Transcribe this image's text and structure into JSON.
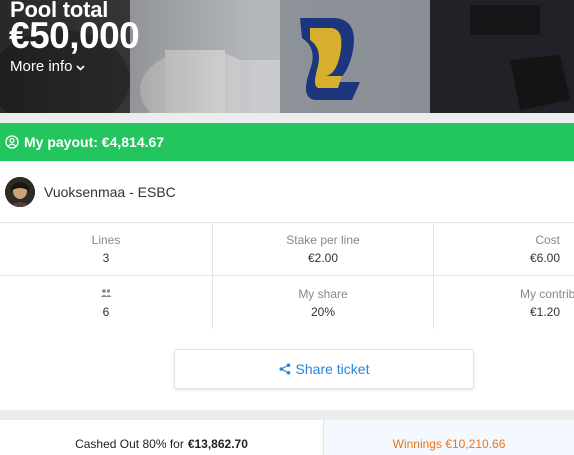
{
  "hero": {
    "pool_label": "Pool total",
    "pool_amount": "€50,000",
    "more_info": "More info"
  },
  "payout": {
    "text": "My payout: €4,814.67",
    "color": "#22c55e"
  },
  "user": {
    "name": "Vuoksenmaa - ESBC"
  },
  "stats": {
    "lines_label": "Lines",
    "lines_value": "3",
    "stake_label": "Stake per line",
    "stake_value": "€2.00",
    "cost_label": "Cost",
    "cost_value": "€6.00",
    "participants_icon": "people-icon",
    "participants_value": "6",
    "share_label": "My share",
    "share_value": "20%",
    "contribution_label": "My contributi",
    "contribution_value": "€1.20"
  },
  "share_button": {
    "label": "Share ticket",
    "icon": "share-icon",
    "color": "#2b84d6"
  },
  "bottom": {
    "cashed_prefix": "Cashed Out 80% for",
    "cashed_amount": "€13,862.70",
    "winnings": "Winnings €10,210.66",
    "winnings_color": "#e8751a"
  }
}
